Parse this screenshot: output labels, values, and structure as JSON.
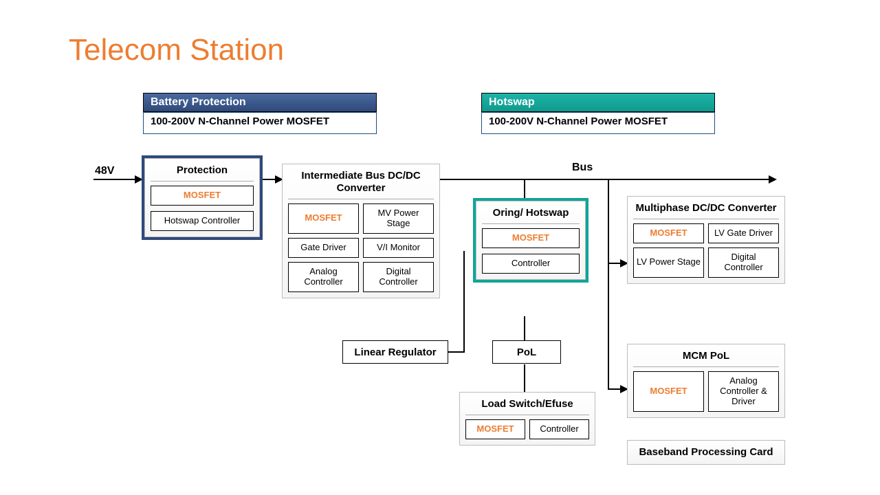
{
  "title": "Telecom Station",
  "headers": {
    "battery_protection": "Battery Protection",
    "hotswap": "Hotswap",
    "sub": "100-200V N-Channel Power MOSFET"
  },
  "labels": {
    "v48": "48V",
    "bus": "Bus",
    "linear_regulator": "Linear Regulator",
    "pol": "PoL"
  },
  "blocks": {
    "protection": {
      "title": "Protection",
      "cells": [
        "MOSFET",
        "Hotswap Controller"
      ]
    },
    "intermediate": {
      "title": "Intermediate Bus DC/DC Converter",
      "cells": [
        "MOSFET",
        "MV Power Stage",
        "Gate Driver",
        "V/I Monitor",
        "Analog Controller",
        "Digital Controller"
      ]
    },
    "oring": {
      "title": "Oring/ Hotswap",
      "cells": [
        "MOSFET",
        "Controller"
      ]
    },
    "multiphase": {
      "title": "Multiphase DC/DC Converter",
      "cells": [
        "MOSFET",
        "LV Gate Driver",
        "LV Power Stage",
        "Digital Controller"
      ]
    },
    "load_switch": {
      "title": "Load Switch/Efuse",
      "cells": [
        "MOSFET",
        "Controller"
      ]
    },
    "mcm_pol": {
      "title": "MCM PoL",
      "cells": [
        "MOSFET",
        "Analog Controller & Driver"
      ]
    },
    "baseband": {
      "title": "Baseband Processing Card"
    }
  }
}
